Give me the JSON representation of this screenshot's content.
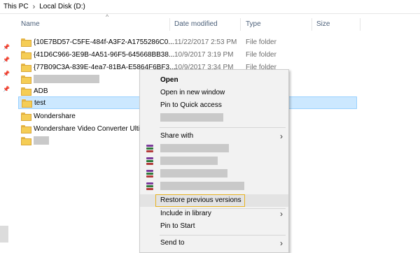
{
  "breadcrumb": {
    "items": [
      "This PC",
      "Local Disk (D:)"
    ],
    "separator": "›"
  },
  "columns": {
    "name": "Name",
    "date": "Date modified",
    "type": "Type",
    "size": "Size"
  },
  "rows": [
    {
      "name": "{10E7BD57-C5FE-484f-A3F2-A1755286C0...",
      "date": "11/22/2017 2:53 PM",
      "type": "File folder"
    },
    {
      "name": "{41D6C966-3E9B-4A51-96F5-645668BB38...",
      "date": "10/9/2017 3:19 PM",
      "type": "File folder"
    },
    {
      "name": "{77B09C3A-839E-4ea7-81BA-E5864F6BF3...",
      "date": "10/9/2017 3:34 PM",
      "type": "File folder"
    },
    {
      "name": "",
      "date": "",
      "type": ""
    },
    {
      "name": "ADB",
      "date": "",
      "type": ""
    },
    {
      "name": "test",
      "date": "",
      "type": ""
    },
    {
      "name": "Wondershare",
      "date": "",
      "type": ""
    },
    {
      "name": "Wondershare Video Converter Ulti",
      "date": "",
      "type": ""
    },
    {
      "name": "",
      "date": "",
      "type": ""
    }
  ],
  "context_menu": {
    "open": "Open",
    "open_new_window": "Open in new window",
    "pin_quick_access": "Pin to Quick access",
    "share_with": "Share with",
    "restore_previous_versions": "Restore previous versions",
    "include_in_library": "Include in library",
    "pin_to_start": "Pin to Start",
    "send_to": "Send to",
    "submenu_arrow": "›"
  },
  "colors": {
    "selection_bg": "#cce8ff",
    "selection_border": "#99d1ff",
    "menu_bg": "#f2f2f2",
    "highlight_border": "#e8b321",
    "folder": "#f5cd55"
  },
  "icons": [
    "folder-icon",
    "pin-icon",
    "winrar-icon",
    "chevron-right-icon"
  ]
}
